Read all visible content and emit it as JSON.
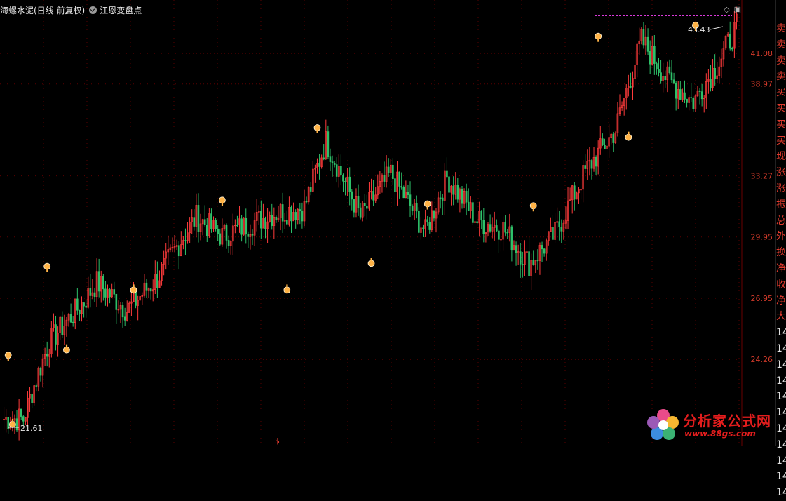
{
  "header": {
    "stock_name": "海螺水泥(日线 前复权)",
    "indicator": "江恩变盘点"
  },
  "icons": {
    "header_indicator": "check-circle-icon",
    "top_right": [
      "diamond-icon",
      "window-icon"
    ]
  },
  "colors": {
    "up": "#ff3b3b",
    "down": "#2ec26a",
    "grid": "#5a0000",
    "axis_label": "#d23a2a",
    "marker": "#ffb347",
    "top_dash": "#d83ad8"
  },
  "price_axis": {
    "ticks": [
      "41.08",
      "38.97",
      "33.27",
      "29.95",
      "26.95",
      "24.26"
    ]
  },
  "annotations": {
    "high_label": "43.43",
    "low_label": "21.61"
  },
  "sidebar": {
    "items": [
      "卖",
      "卖",
      "卖",
      "卖",
      "买",
      "买",
      "买",
      "买",
      "现",
      "涨",
      "涨",
      "振",
      "总",
      "外",
      "换",
      "净",
      "收",
      "净",
      "大",
      "14",
      "14",
      "14",
      "14",
      "14",
      "14",
      "14",
      "14",
      "14",
      "14",
      "14"
    ]
  },
  "watermark": {
    "brand": "分析家公式网",
    "url": "www.88gs.com"
  },
  "bottom": {
    "marker": "$"
  },
  "chart_data": {
    "type": "candlestick",
    "title": "",
    "xlabel": "",
    "ylabel": "",
    "ylim": [
      21.61,
      43.43
    ],
    "y_scale": "log",
    "y_ticks": [
      41.08,
      38.97,
      33.27,
      29.95,
      26.95,
      24.26
    ],
    "grid": true,
    "bars": 340,
    "segments": [
      {
        "from": 0,
        "to": 10,
        "close": 21.9
      },
      {
        "from": 10,
        "to": 22,
        "close": 25.0
      },
      {
        "from": 22,
        "to": 38,
        "close": 26.8
      },
      {
        "from": 38,
        "to": 44,
        "close": 27.7
      },
      {
        "from": 44,
        "to": 58,
        "close": 26.4
      },
      {
        "from": 58,
        "to": 72,
        "close": 27.9
      },
      {
        "from": 72,
        "to": 90,
        "close": 31.0
      },
      {
        "from": 90,
        "to": 102,
        "close": 30.0
      },
      {
        "from": 102,
        "to": 126,
        "close": 31.2
      },
      {
        "from": 126,
        "to": 140,
        "close": 31.5
      },
      {
        "from": 140,
        "to": 150,
        "close": 35.3
      },
      {
        "from": 150,
        "to": 166,
        "close": 31.0
      },
      {
        "from": 166,
        "to": 180,
        "close": 33.4
      },
      {
        "from": 180,
        "to": 196,
        "close": 30.2
      },
      {
        "from": 196,
        "to": 206,
        "close": 33.2
      },
      {
        "from": 206,
        "to": 220,
        "close": 30.8
      },
      {
        "from": 220,
        "to": 232,
        "close": 30.4
      },
      {
        "from": 232,
        "to": 244,
        "close": 28.6
      },
      {
        "from": 244,
        "to": 256,
        "close": 30.1
      },
      {
        "from": 256,
        "to": 270,
        "close": 33.5
      },
      {
        "from": 270,
        "to": 284,
        "close": 36.0
      },
      {
        "from": 284,
        "to": 296,
        "close": 42.0
      },
      {
        "from": 296,
        "to": 308,
        "close": 39.3
      },
      {
        "from": 308,
        "to": 320,
        "close": 37.8
      },
      {
        "from": 320,
        "to": 332,
        "close": 40.5
      },
      {
        "from": 332,
        "to": 340,
        "close": 43.0
      }
    ],
    "markers": [
      {
        "bar": 2,
        "price": 24.2,
        "kind": "high"
      },
      {
        "bar": 4,
        "price": 21.9,
        "kind": "low"
      },
      {
        "bar": 20,
        "price": 28.2,
        "kind": "high"
      },
      {
        "bar": 29,
        "price": 24.9,
        "kind": "low"
      },
      {
        "bar": 60,
        "price": 27.6,
        "kind": "low"
      },
      {
        "bar": 101,
        "price": 31.6,
        "kind": "high"
      },
      {
        "bar": 131,
        "price": 27.6,
        "kind": "low"
      },
      {
        "bar": 145,
        "price": 35.8,
        "kind": "high"
      },
      {
        "bar": 170,
        "price": 28.9,
        "kind": "low"
      },
      {
        "bar": 196,
        "price": 31.4,
        "kind": "high"
      },
      {
        "bar": 245,
        "price": 31.3,
        "kind": "high"
      },
      {
        "bar": 275,
        "price": 41.9,
        "kind": "high"
      },
      {
        "bar": 289,
        "price": 35.9,
        "kind": "low"
      },
      {
        "bar": 320,
        "price": 42.7,
        "kind": "high"
      }
    ]
  }
}
